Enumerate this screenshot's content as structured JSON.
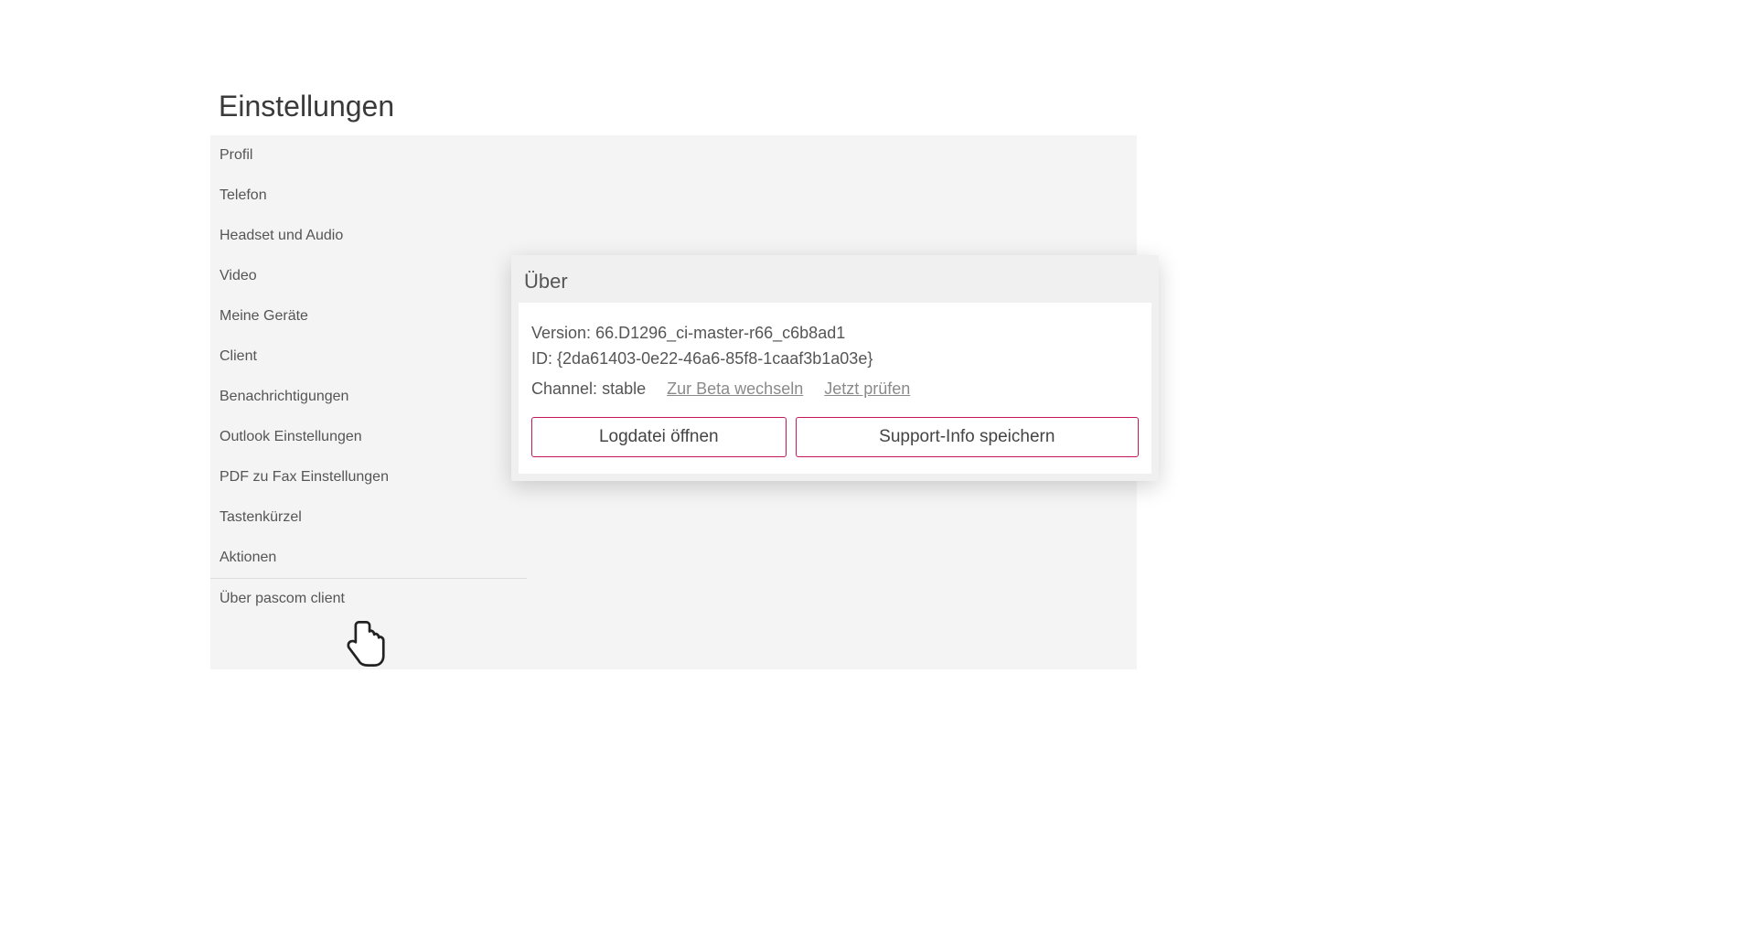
{
  "pageTitle": "Einstellungen",
  "sidebar": {
    "items": [
      {
        "label": "Profil"
      },
      {
        "label": "Telefon"
      },
      {
        "label": "Headset und Audio"
      },
      {
        "label": "Video"
      },
      {
        "label": "Meine Geräte"
      },
      {
        "label": "Client"
      },
      {
        "label": "Benachrichtigungen"
      },
      {
        "label": "Outlook Einstellungen"
      },
      {
        "label": "PDF zu Fax Einstellungen"
      },
      {
        "label": "Tastenkürzel"
      },
      {
        "label": "Aktionen"
      },
      {
        "label": "Über pascom client"
      }
    ]
  },
  "about": {
    "title": "Über",
    "versionLabel": "Version:",
    "versionValue": "66.D1296_ci-master-r66_c6b8ad1",
    "idLabel": "ID:",
    "idValue": "{2da61403-0e22-46a6-85f8-1caaf3b1a03e}",
    "channelLabel": "Channel:",
    "channelValue": "stable",
    "switchBetaLink": "Zur Beta wechseln",
    "checkNowLink": "Jetzt prüfen",
    "openLogBtn": "Logdatei öffnen",
    "saveSupportBtn": "Support-Info speichern"
  }
}
